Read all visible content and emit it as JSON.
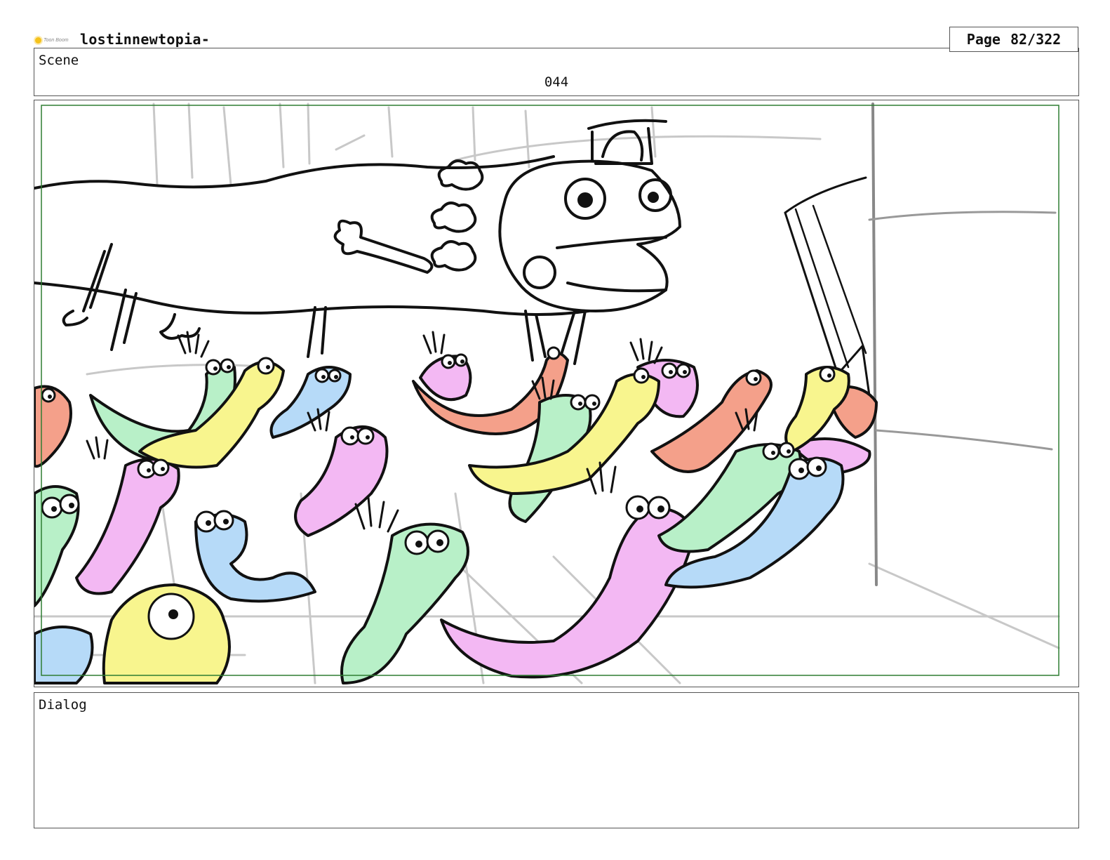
{
  "header": {
    "logo_text": "Toon Boom",
    "project_title": "lostinnewtopia-",
    "page_label": "Page",
    "page_number": "82/322"
  },
  "scene": {
    "label": "Scene",
    "number": "044"
  },
  "panel": {
    "safe_frame_color": "#2e7d32",
    "palette": {
      "green": "#b8f0c8",
      "yellow": "#f8f58e",
      "pink": "#f3b8f3",
      "blue": "#b6daf8",
      "red": "#f4a08a",
      "layout_lines": "#c8c8c8",
      "ink": "#111111"
    }
  },
  "dialog": {
    "label": "Dialog",
    "text": ""
  }
}
